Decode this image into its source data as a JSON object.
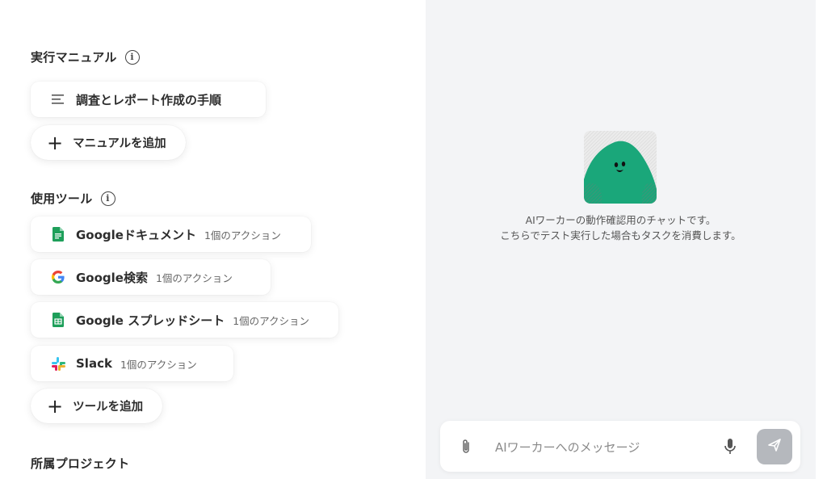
{
  "manual_section": {
    "title": "実行マニュアル",
    "items": [
      {
        "label": "調査とレポート作成の手順"
      }
    ],
    "add_label": "マニュアルを追加"
  },
  "tools_section": {
    "title": "使用ツール",
    "items": [
      {
        "label": "Googleドキュメント",
        "sub": "1個のアクション",
        "icon": "google-docs-icon"
      },
      {
        "label": "Google検索",
        "sub": "1個のアクション",
        "icon": "google-g-icon"
      },
      {
        "label": "Google スプレッドシート",
        "sub": "1個のアクション",
        "icon": "google-sheets-icon"
      },
      {
        "label": "Slack",
        "sub": "1個のアクション",
        "icon": "slack-icon"
      }
    ],
    "add_label": "ツールを追加"
  },
  "project_section": {
    "title": "所属プロジェクト"
  },
  "chat": {
    "message_line1": "AIワーカーの動作確認用のチャットです。",
    "message_line2": "こちらでテスト実行した場合もタスクを消費します。",
    "input_placeholder": "AIワーカーへのメッセージ"
  },
  "colors": {
    "mascot_green": "#1aa77a",
    "docs_blue": "#1a73e8",
    "sheets_green": "#1e9f5a",
    "send_button": "#b5b8bd",
    "chat_background": "#f3f4f6"
  }
}
